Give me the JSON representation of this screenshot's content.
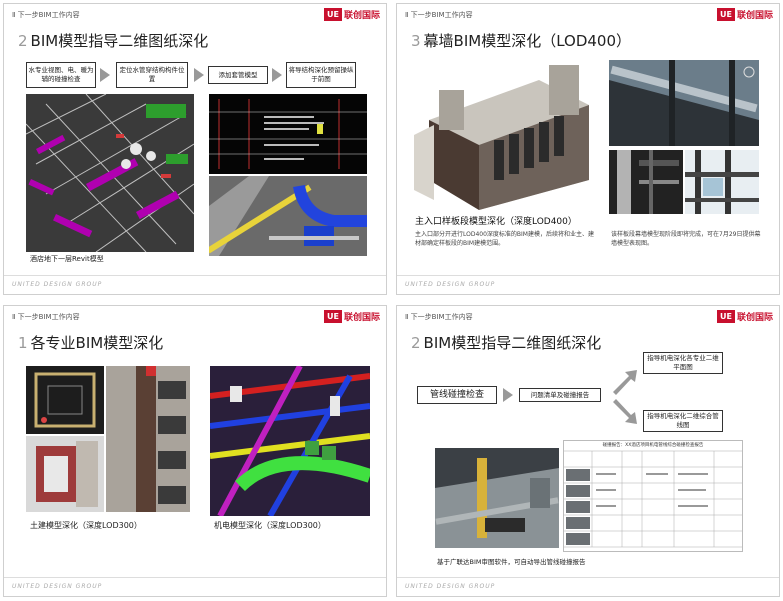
{
  "header": {
    "section": "Ⅱ 下一步BIM工作内容",
    "logo_mark": "UE",
    "logo_text": "联创国际"
  },
  "footer": {
    "text": "UNITED DESIGN GROUP"
  },
  "slides": [
    {
      "num": "2",
      "title": "BIM模型指导二维图纸深化",
      "flow": [
        "水专业视图、电、暖为辅的碰撞检查",
        "定位水管穿结构构件位置",
        "添加套管模型",
        "将导结构深化预留操纵于前图"
      ],
      "caption": "酒店地下一层Revit模型"
    },
    {
      "num": "3",
      "title": "幕墙BIM模型深化（LOD400）",
      "sub_title": "主入口样板段模型深化（深度LOD400）",
      "sub_desc": "主入口部分开进行LOD400深度标准的BIM建模，后续将和业主、建材部确定样板段的BIM建模范围。",
      "right_desc": "该样板段幕墙模型现阶段即将完成，可在7月29日提供幕墙模型表现图。"
    },
    {
      "num": "1",
      "title": "各专业BIM模型深化",
      "cap_left": "土建模型深化（深度LOD300）",
      "cap_right": "机电模型深化（深度LOD300）"
    },
    {
      "num": "2",
      "title": "BIM模型指导二维图纸深化",
      "box_main": "管线碰撞检查",
      "box_report": "问题清单及碰撞报告",
      "box_top": "指导机电深化各专业二维平面图",
      "box_bottom": "指导机电深化二维综合管线图",
      "table_title": "碰撞报告：XX酒店项目机电管线综合碰撞检查报告",
      "caption": "基于广联达BIM审图软件，可自动导出管线碰撞报告"
    }
  ]
}
